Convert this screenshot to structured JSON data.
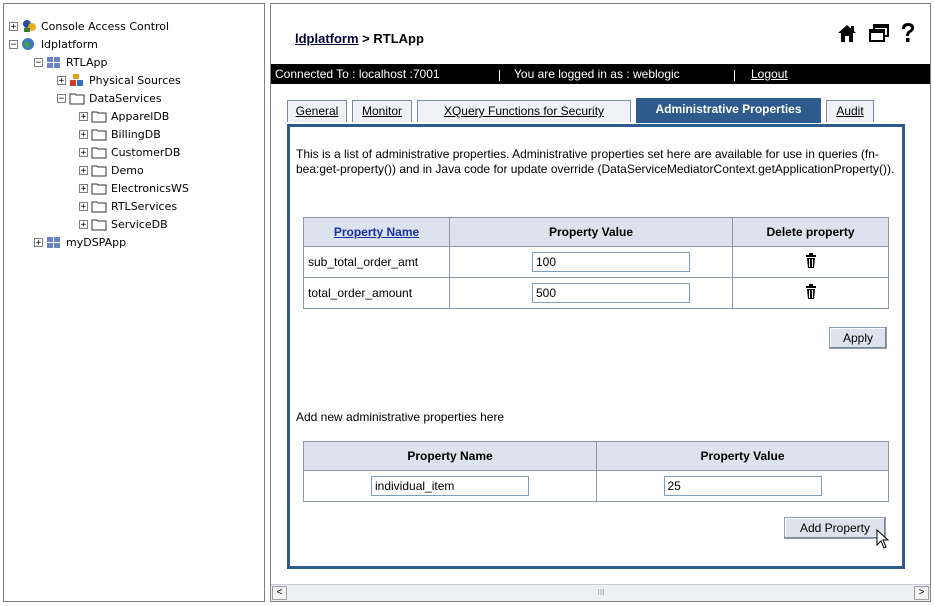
{
  "tree": {
    "nodes": [
      {
        "label": "Console Access Control",
        "expander": "+",
        "icon": "access-control-icon"
      },
      {
        "label": "ldplatform",
        "expander": "−",
        "icon": "globe-icon"
      },
      {
        "label": "RTLApp",
        "expander": "−",
        "icon": "application-icon"
      },
      {
        "label": "Physical Sources",
        "expander": "+",
        "icon": "physical-sources-icon"
      },
      {
        "label": "DataServices",
        "expander": "−",
        "icon": "folder-icon"
      },
      {
        "label": "ApparelDB",
        "expander": "+",
        "icon": "folder-icon"
      },
      {
        "label": "BillingDB",
        "expander": "+",
        "icon": "folder-icon"
      },
      {
        "label": "CustomerDB",
        "expander": "+",
        "icon": "folder-icon"
      },
      {
        "label": "Demo",
        "expander": "+",
        "icon": "folder-icon"
      },
      {
        "label": "ElectronicsWS",
        "expander": "+",
        "icon": "folder-icon"
      },
      {
        "label": "RTLServices",
        "expander": "+",
        "icon": "folder-icon"
      },
      {
        "label": "ServiceDB",
        "expander": "+",
        "icon": "folder-icon"
      },
      {
        "label": "myDSPApp",
        "expander": "+",
        "icon": "application-icon"
      }
    ]
  },
  "header": {
    "breadcrumb_link": "ldplatform",
    "breadcrumb_rest": " > RTLApp",
    "icons": [
      "home-icon",
      "window-icon",
      "help-icon"
    ]
  },
  "status": {
    "connected": "Connected To :  localhost :7001",
    "logged_in": "You are logged in as :  weblogic",
    "logout": "Logout"
  },
  "tabs": [
    "General",
    "Monitor",
    "XQuery Functions for Security",
    "Administrative Properties",
    "Audit"
  ],
  "active_tab": "Administrative Properties",
  "intro": "This is a list of administrative properties. Administrative properties set here are available for use in queries (fn-bea:get-property()) and in Java code for update override (DataServiceMediatorContext.getApplicationProperty()).",
  "props_table": {
    "headers": [
      "Property Name",
      "Property Value",
      "Delete property"
    ],
    "rows": [
      {
        "name": "sub_total_order_amt",
        "value": "100"
      },
      {
        "name": "total_order_amount",
        "value": "500"
      }
    ]
  },
  "apply_label": "Apply",
  "add_heading": "Add new administrative properties here",
  "new_table": {
    "headers": [
      "Property Name",
      "Property Value"
    ],
    "name_value": "individual_item",
    "value_value": "25"
  },
  "add_button": "Add Property",
  "scroll": {
    "left": "<",
    "right": ">",
    "grip": "III"
  }
}
